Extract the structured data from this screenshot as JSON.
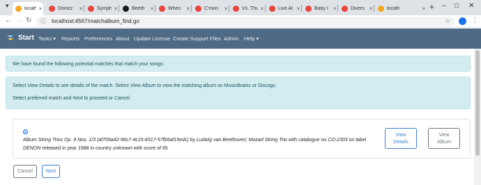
{
  "browser": {
    "tabs": [
      {
        "title": "localho",
        "active": true,
        "favicon_color": "#f5a623"
      },
      {
        "title": "Donizz",
        "active": false,
        "favicon_color": "#e8453c"
      },
      {
        "title": "Symph",
        "active": false,
        "favicon_color": "#e8453c"
      },
      {
        "title": "Beeth",
        "active": false,
        "favicon_color": "#1a1a1a"
      },
      {
        "title": "When",
        "active": false,
        "favicon_color": "#e8453c"
      },
      {
        "title": "C'mon",
        "active": false,
        "favicon_color": "#e8453c"
      },
      {
        "title": "Vs. Thu",
        "active": false,
        "favicon_color": "#e8453c"
      },
      {
        "title": "Live At",
        "active": false,
        "favicon_color": "#e8453c"
      },
      {
        "title": "Baby I",
        "active": false,
        "favicon_color": "#e8453c"
      },
      {
        "title": "Divers",
        "active": false,
        "favicon_color": "#e8453c"
      },
      {
        "title": "localh",
        "active": false,
        "favicon_color": "#f5a623"
      }
    ],
    "tab_close_glyph": "×",
    "new_tab_glyph": "+",
    "url": "localhost:4567/matchalbum_find.go"
  },
  "navbar": {
    "brand": "Start",
    "items": [
      "Tasks ▾",
      "Reports",
      "Preferences",
      "About",
      "Update License",
      "Create Support Files",
      "Admin",
      "Help ▾"
    ]
  },
  "alerts": {
    "found": "We have found the following potential matches that match your songs:",
    "instructions": {
      "p1": "Select ",
      "view_details": "View Details",
      "p2": " to see details of the match. Select ",
      "view_album": "View Album",
      "p3": " to view the matching album on MusicBrainz or Discogs."
    },
    "select": {
      "p1": "Select preferred match and ",
      "next": "Next",
      "p2": " to proceed or ",
      "cancel": "Cancel",
      "p3": "."
    }
  },
  "match": {
    "w_album": "Album ",
    "album_title": "String Trios Op. 9 Nos. 1/3 (af709a42-96c7-4c15-8317-57fb5af15edc)",
    "w_by": " by ",
    "artist": "Ludwig van Beethoven; Mozart String Trio",
    "w_catalogue": " with catalogue no ",
    "catalogue_no": "CO-2303",
    "w_label": " on label ",
    "label": "DENON",
    "w_year": " released in year ",
    "year": "1988",
    "w_country": " in country ",
    "country": "unknown",
    "w_score": " with score of ",
    "score": "65"
  },
  "buttons": {
    "view_details": [
      "View",
      "Details"
    ],
    "view_album": [
      "View",
      "Album"
    ],
    "cancel": "Cancel",
    "next": "Next"
  },
  "colors": {
    "navbar": "#4e6a85",
    "alert_bg": "#d2ecf0",
    "primary": "#3d7fd4"
  }
}
